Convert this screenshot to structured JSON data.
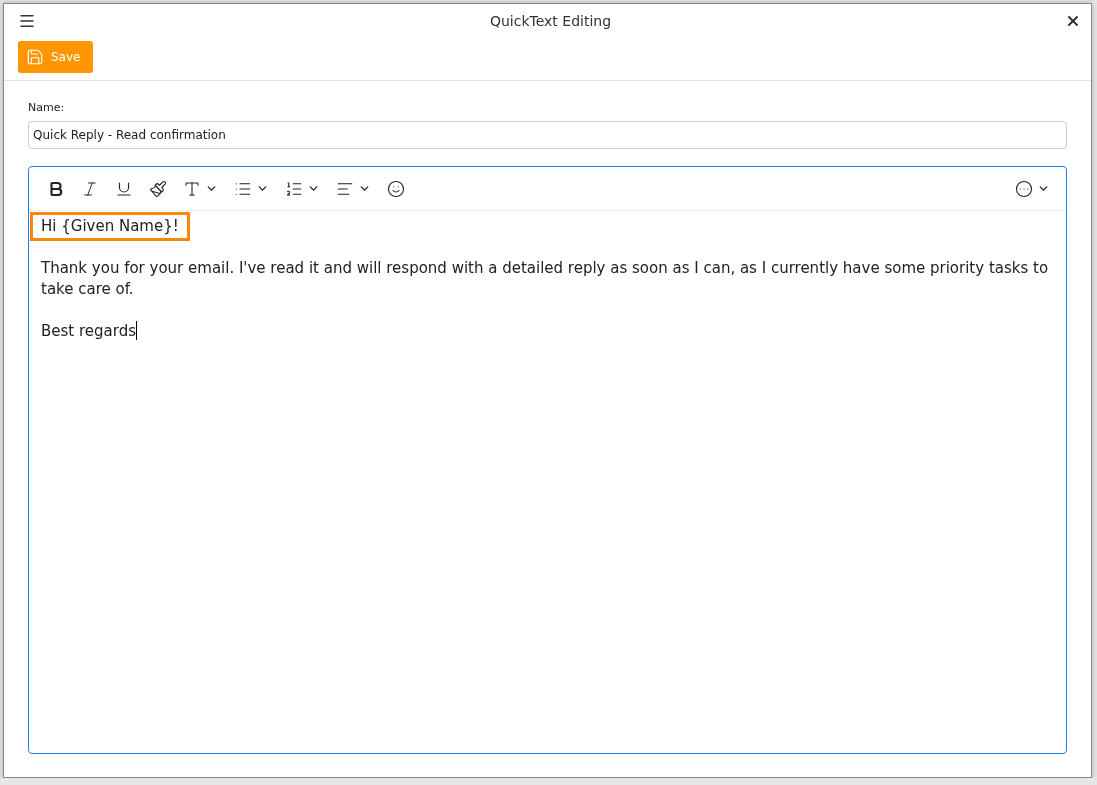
{
  "window": {
    "title": "QuickText Editing"
  },
  "toolbar": {
    "save_button": "Save"
  },
  "name_field": {
    "label": "Name:",
    "value": "Quick Reply - Read confirmation"
  },
  "editor": {
    "focused": true,
    "format_tools": [
      {
        "kind": "bold",
        "dropdown": false
      },
      {
        "kind": "italic",
        "dropdown": false
      },
      {
        "kind": "underline",
        "dropdown": false
      },
      {
        "kind": "format-painter",
        "dropdown": false
      },
      {
        "kind": "font",
        "dropdown": true
      },
      {
        "kind": "bullet-list",
        "dropdown": true
      },
      {
        "kind": "numbered-list",
        "dropdown": true
      },
      {
        "kind": "align",
        "dropdown": true
      },
      {
        "kind": "emoji",
        "dropdown": false
      }
    ],
    "more_tools": {
      "dropdown": true
    },
    "paragraphs": [
      {
        "text": "Hi {Given Name}!",
        "highlighted": true,
        "cursor": false
      },
      {
        "text": "Thank you for your email. I've read it and will respond with a detailed reply as soon as I can, as I currently have some priority tasks to take care of.",
        "highlighted": false,
        "cursor": false
      },
      {
        "text": "Best regards",
        "highlighted": false,
        "cursor": true
      }
    ]
  }
}
